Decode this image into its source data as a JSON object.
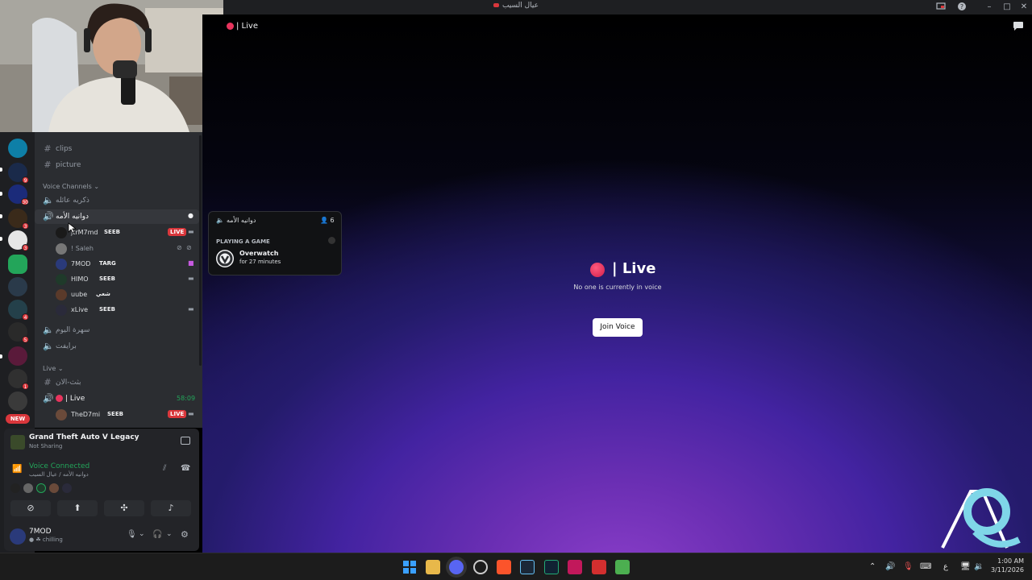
{
  "window": {
    "title": "عيال السيب",
    "icons": [
      "screen-share-icon",
      "help-icon",
      "minimize-icon",
      "maximize-icon",
      "close-icon"
    ]
  },
  "channels": {
    "text": [
      {
        "name": "clips"
      },
      {
        "name": "picture"
      }
    ],
    "voice_category": "Voice Channels",
    "voice": [
      {
        "name": "ذكريه عائله"
      },
      {
        "name": "دوانيه الأمه"
      },
      {
        "name": "سهرة اليوم"
      },
      {
        "name": "برايفت"
      }
    ],
    "voice_users": [
      {
        "name": "jtrM7md",
        "tag": "SEEB",
        "live": "LIVE"
      },
      {
        "name": "! Saleh",
        "tag": ""
      },
      {
        "name": "7MOD",
        "tag": "TARG"
      },
      {
        "name": "HIMO",
        "tag": "SEEB"
      },
      {
        "name": "uube",
        "tag": "شعي"
      },
      {
        "name": "xLive",
        "tag": "SEEB"
      }
    ],
    "live_category": "Live",
    "live_text_channel": "بثث-الان",
    "live_voice": {
      "name": "| Live",
      "time": "58:09"
    },
    "live_user": {
      "name": "TheD7mi",
      "tag": "SEEB",
      "live": "LIVE"
    }
  },
  "servers": {
    "badges": [
      "9",
      "30",
      "3",
      "3",
      "4",
      "5",
      "1"
    ],
    "new_label": "NEW"
  },
  "activity": {
    "game": "Grand Theft Auto V Legacy",
    "status": "Not Sharing"
  },
  "voice_panel": {
    "status": "Voice Connected",
    "location": "دوانيه الأمه / عيال السيب"
  },
  "user_panel": {
    "username": "7MOD",
    "status": "chilling"
  },
  "main": {
    "header": "| Live",
    "title": "| Live",
    "subtitle": "No one is currently in voice",
    "join_button": "Join Voice"
  },
  "popup": {
    "channel": "دوانيه الأمه",
    "count": "6",
    "section": "PLAYING A GAME",
    "game": "Overwatch",
    "duration": "for 27 minutes"
  },
  "taskbar": {
    "time": "1:00 AM",
    "date": "3/11/2026",
    "lang": "ع"
  },
  "colors": {
    "accent_live": "#da373c",
    "voice_connected": "#23a55a",
    "bg_sidebar": "#2b2d31",
    "bg_rail": "#1e1f22"
  }
}
